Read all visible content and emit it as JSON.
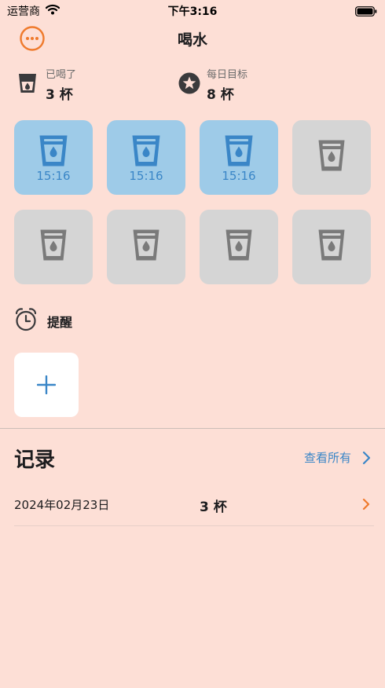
{
  "status_bar": {
    "carrier": "运营商",
    "time": "下午3:16"
  },
  "header": {
    "title": "喝水",
    "menu_icon": "more-icon",
    "accent": "#ef7a2c"
  },
  "stats": {
    "drunk": {
      "label": "已喝了",
      "value": "3 杯",
      "icon": "cup-icon"
    },
    "goal": {
      "label": "每日目标",
      "value": "8 杯",
      "icon": "star-badge-icon"
    }
  },
  "cups": [
    {
      "filled": true,
      "time": "15:16"
    },
    {
      "filled": true,
      "time": "15:16"
    },
    {
      "filled": true,
      "time": "15:16"
    },
    {
      "filled": false
    },
    {
      "filled": false
    },
    {
      "filled": false
    },
    {
      "filled": false
    },
    {
      "filled": false
    }
  ],
  "reminder": {
    "label": "提醒",
    "icon": "alarm-clock-icon",
    "add_icon": "plus-icon"
  },
  "records": {
    "title": "记录",
    "view_all": "查看所有",
    "items": [
      {
        "date": "2024年02月23日",
        "count": "3 杯"
      }
    ]
  },
  "colors": {
    "background": "#fddfd6",
    "filled_tile": "#9ecbe8",
    "empty_tile": "#d5d5d5",
    "blue": "#3a86c7",
    "orange": "#ef7a2c"
  }
}
